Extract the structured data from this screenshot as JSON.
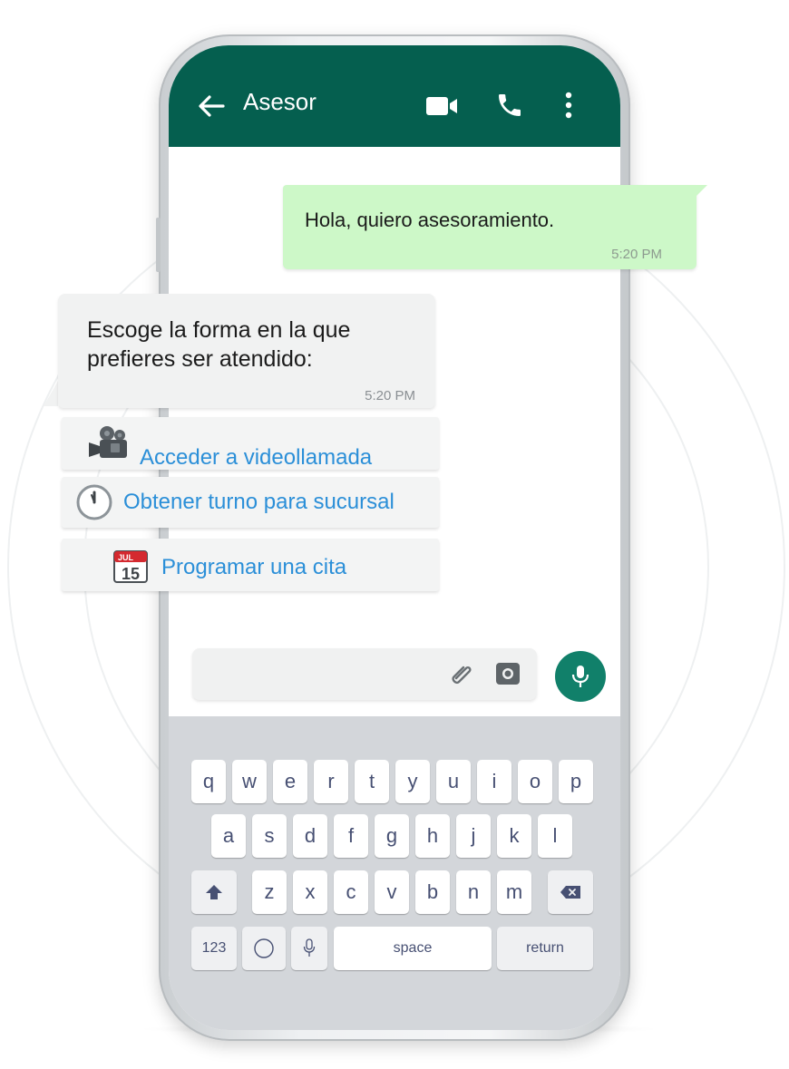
{
  "header": {
    "title": "Asesor",
    "back_icon": "arrow-left-icon",
    "video_icon": "video-camera-icon",
    "call_icon": "phone-icon",
    "menu_icon": "kebab-menu-icon",
    "color": "#055f4f"
  },
  "messages": [
    {
      "text": "Hola, quiero asesoramiento.",
      "time": "5:20 PM",
      "direction": "outgoing",
      "color": "#cdf8c8"
    },
    {
      "text": "Escoge la forma en la que prefieres ser atendido:",
      "time": "5:20 PM",
      "direction": "incoming",
      "color": "#f1f2f2"
    }
  ],
  "options": [
    {
      "label": "Acceder a videollamada",
      "icon": "movie-camera-icon"
    },
    {
      "label": "Obtener turno para sucursal",
      "icon": "clock-icon"
    },
    {
      "label": "Programar una cita",
      "icon": "calendar-icon"
    }
  ],
  "calendar_icon": {
    "month": "JUL",
    "day": "15"
  },
  "composer": {
    "attach_icon": "paperclip-icon",
    "camera_icon": "camera-icon",
    "mic_icon": "microphone-icon",
    "accent": "#11806a"
  },
  "keyboard": {
    "row1": [
      "q",
      "w",
      "e",
      "r",
      "t",
      "y",
      "u",
      "i",
      "o",
      "p"
    ],
    "row2": [
      "a",
      "s",
      "d",
      "f",
      "g",
      "h",
      "j",
      "k",
      "l"
    ],
    "row3": [
      "z",
      "x",
      "c",
      "v",
      "b",
      "n",
      "m"
    ],
    "shift_icon": "shift-icon",
    "backspace_icon": "backspace-icon",
    "numbers": "123",
    "globe_icon": "globe-icon",
    "dictation_icon": "microphone-icon",
    "space": "space",
    "return": "return"
  }
}
